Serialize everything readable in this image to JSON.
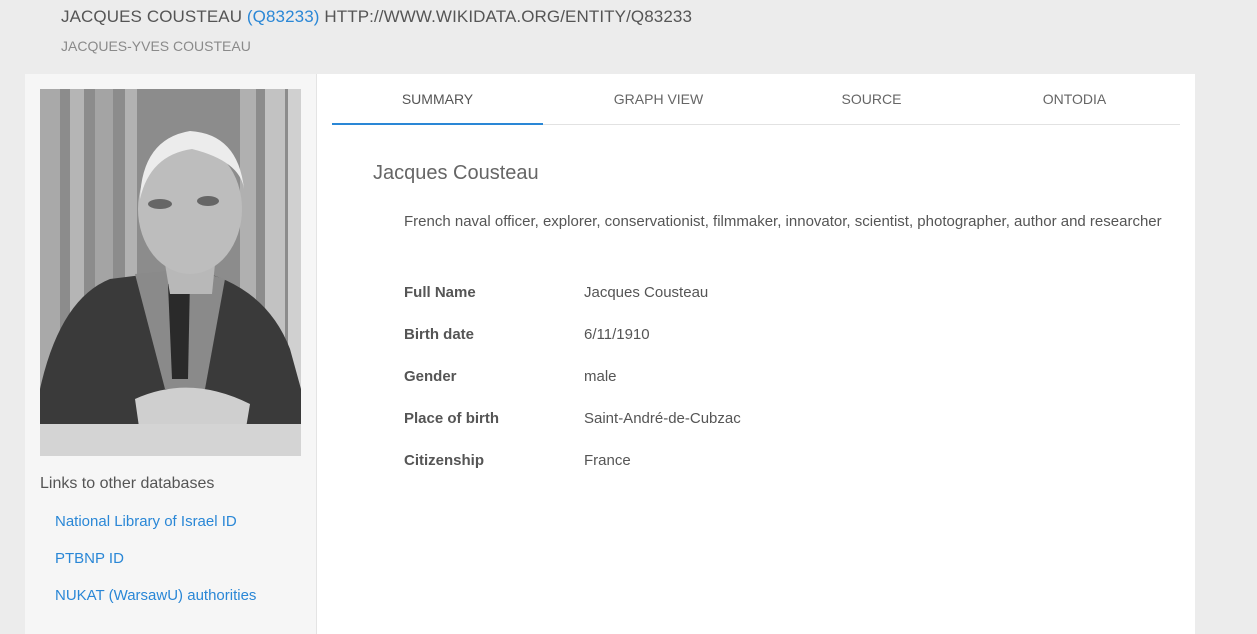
{
  "header": {
    "title": "JACQUES COUSTEAU",
    "entity_id_link": "(Q83233)",
    "entity_url": "HTTP://WWW.WIKIDATA.ORG/ENTITY/Q83233",
    "subtitle": "JACQUES-YVES COUSTEAU"
  },
  "sidebar": {
    "links_heading": "Links to other databases",
    "links": [
      "National Library of Israel ID",
      "PTBNP ID",
      "NUKAT (WarsawU) authorities"
    ]
  },
  "tabs": [
    {
      "label": "SUMMARY",
      "active": true
    },
    {
      "label": "GRAPH VIEW",
      "active": false
    },
    {
      "label": "SOURCE",
      "active": false
    },
    {
      "label": "ONTODIA",
      "active": false
    }
  ],
  "summary": {
    "name": "Jacques Cousteau",
    "description": "French naval officer, explorer, conservationist, filmmaker, innovator, scientist, photographer, author and researcher",
    "properties": [
      {
        "label": "Full Name",
        "value": "Jacques Cousteau"
      },
      {
        "label": "Birth date",
        "value": "6/11/1910"
      },
      {
        "label": "Gender",
        "value": "male"
      },
      {
        "label": "Place of birth",
        "value": "Saint-André-de-Cubzac"
      },
      {
        "label": "Citizenship",
        "value": "France"
      }
    ]
  },
  "colors": {
    "page_background": "#ececec",
    "link": "#2a87d6",
    "active_tab_underline": "#2a87d6"
  }
}
